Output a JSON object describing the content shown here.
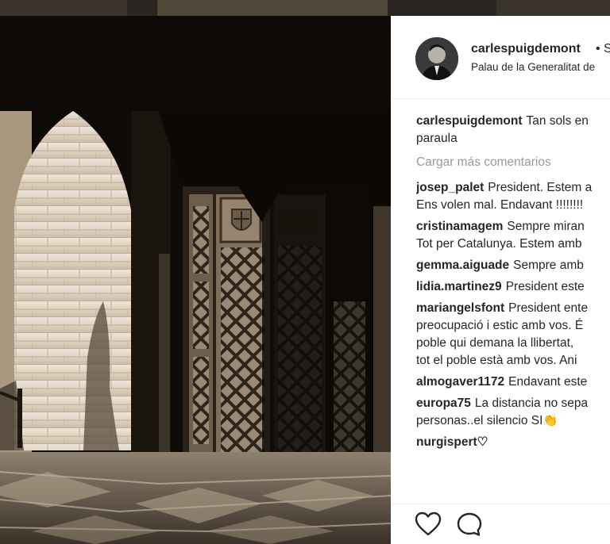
{
  "post": {
    "username": "carlespuigdemont",
    "follow_text": "• S",
    "location": "Palau de la Generalitat de"
  },
  "caption": {
    "username": "carlespuigdemont",
    "lines": [
      "Tan sols en",
      "paraula"
    ]
  },
  "load_more_label": "Cargar más comentarios",
  "comments": [
    {
      "user": "josep_palet",
      "lines": [
        "President. Estem a",
        "Ens volen mal. Endavant !!!!!!!!"
      ]
    },
    {
      "user": "cristinamagem",
      "lines": [
        "Sempre miran",
        "Tot per Catalunya. Estem amb"
      ]
    },
    {
      "user": "gemma.aiguade",
      "lines": [
        "Sempre amb"
      ]
    },
    {
      "user": "lidia.martinez9",
      "lines": [
        "President este"
      ]
    },
    {
      "user": "mariangelsfont",
      "lines": [
        "President ente",
        "preocupació i estic amb vos. É",
        "poble qui demana la llibertat,",
        "tot el poble està amb vos. Ani"
      ]
    },
    {
      "user": "almogaver1172",
      "lines": [
        "Endavant este"
      ]
    },
    {
      "user": "europa75",
      "lines": [
        "La distancia no sepa",
        "personas..el silencio SI👏"
      ]
    },
    {
      "user": "nurgispert♡",
      "lines": []
    }
  ],
  "icons": {
    "like": "heart-icon",
    "comment": "comment-icon"
  },
  "colors": {
    "text": "#262626",
    "muted": "#999999",
    "photo_tone": "#d6c7b0"
  }
}
